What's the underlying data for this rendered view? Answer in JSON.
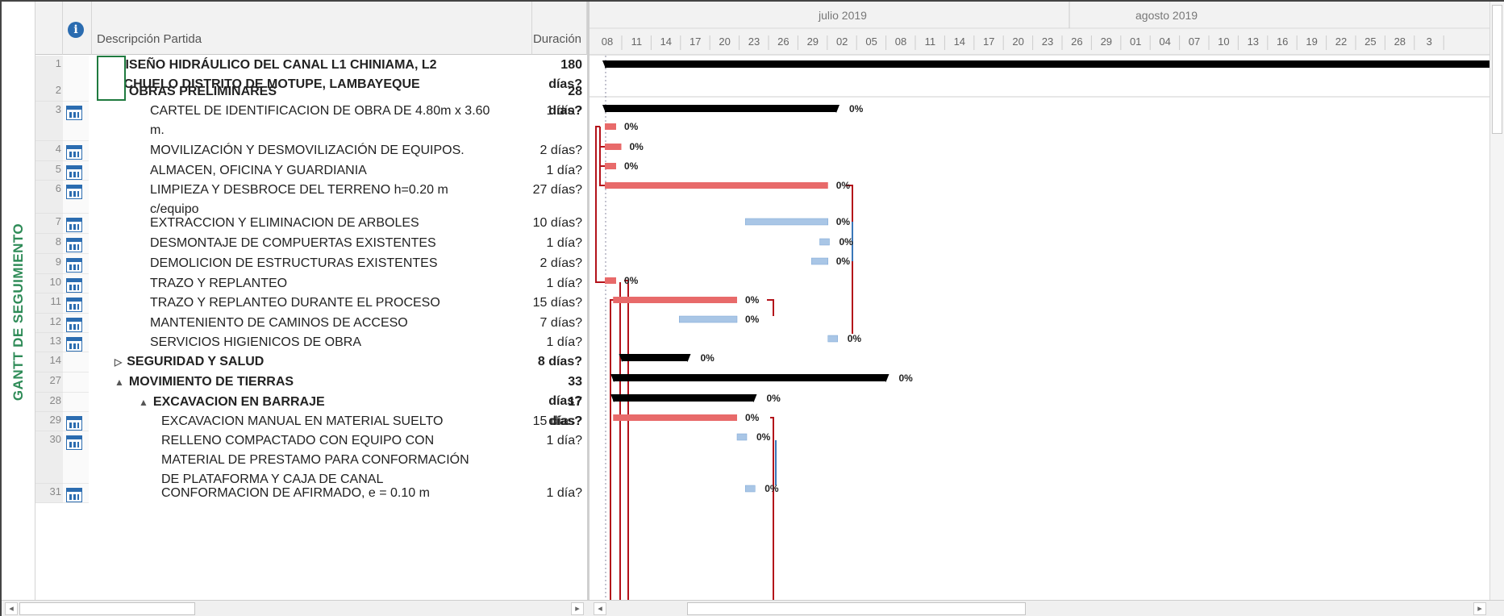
{
  "side_label": "GANTT DE SEGUIMIENTO",
  "columns": {
    "info_icon": "info-icon",
    "name": "Descripción Partida",
    "duration": "Duración"
  },
  "timeline": {
    "months": [
      {
        "label": "julio 2019"
      },
      {
        "label": "agosto 2019"
      }
    ],
    "days": [
      "08",
      "11",
      "14",
      "17",
      "20",
      "23",
      "26",
      "29",
      "02",
      "05",
      "08",
      "11",
      "14",
      "17",
      "20",
      "23",
      "26",
      "29",
      "01",
      "04",
      "07",
      "10",
      "13",
      "16",
      "19",
      "22",
      "25",
      "28",
      "3"
    ]
  },
  "rows": [
    {
      "id": "1",
      "name": "DISEÑO HIDRÁULICO DEL CANAL L1 CHINIAMA, L2",
      "name2": "RIACHUELO DISTRITO DE MOTUPE, LAMBAYEQUE",
      "duration": "180 días?",
      "bold": true,
      "level": 0,
      "expand": "▲",
      "icon": false
    },
    {
      "id": "2",
      "name": "OBRAS PRELIMINARES",
      "duration": "28 días?",
      "bold": true,
      "level": 1,
      "expand": "▲",
      "icon": false
    },
    {
      "id": "3",
      "name": "CARTEL DE IDENTIFICACION DE OBRA DE 4.80m x 3.60",
      "name2": "m.",
      "duration": "1 día?",
      "bold": false,
      "level": 2,
      "icon": true
    },
    {
      "id": "4",
      "name": "MOVILIZACIÓN Y DESMOVILIZACIÓN DE EQUIPOS.",
      "duration": "2 días?",
      "bold": false,
      "level": 2,
      "icon": true
    },
    {
      "id": "5",
      "name": "ALMACEN, OFICINA Y GUARDIANIA",
      "duration": "1 día?",
      "bold": false,
      "level": 2,
      "icon": true
    },
    {
      "id": "6",
      "name": "LIMPIEZA Y DESBROCE DEL TERRENO h=0.20 m",
      "name2": "c/equipo",
      "duration": "27 días?",
      "bold": false,
      "level": 2,
      "icon": true
    },
    {
      "id": "7",
      "name": "EXTRACCION Y ELIMINACION DE ARBOLES",
      "duration": "10 días?",
      "bold": false,
      "level": 2,
      "icon": true
    },
    {
      "id": "8",
      "name": "DESMONTAJE DE COMPUERTAS EXISTENTES",
      "duration": "1 día?",
      "bold": false,
      "level": 2,
      "icon": true
    },
    {
      "id": "9",
      "name": "DEMOLICION DE ESTRUCTURAS EXISTENTES",
      "duration": "2 días?",
      "bold": false,
      "level": 2,
      "icon": true
    },
    {
      "id": "10",
      "name": "TRAZO Y REPLANTEO",
      "duration": "1 día?",
      "bold": false,
      "level": 2,
      "icon": true
    },
    {
      "id": "11",
      "name": "TRAZO Y REPLANTEO DURANTE EL PROCESO",
      "duration": "15 días?",
      "bold": false,
      "level": 2,
      "icon": true
    },
    {
      "id": "12",
      "name": "MANTENIENTO DE CAMINOS DE ACCESO",
      "duration": "7 días?",
      "bold": false,
      "level": 2,
      "icon": true
    },
    {
      "id": "13",
      "name": "SERVICIOS HIGIENICOS DE OBRA",
      "duration": "1 día?",
      "bold": false,
      "level": 2,
      "icon": true
    },
    {
      "id": "14",
      "name": "SEGURIDAD Y SALUD",
      "duration": "8 días?",
      "bold": true,
      "level": 1,
      "expand": "▷",
      "icon": false
    },
    {
      "id": "27",
      "name": "MOVIMIENTO DE TIERRAS",
      "duration": "33 días?",
      "bold": true,
      "level": 1,
      "expand": "▲",
      "icon": false
    },
    {
      "id": "28",
      "name": "EXCAVACION EN BARRAJE",
      "duration": "17 días?",
      "bold": true,
      "level": 2,
      "expand": "▲",
      "icon": false
    },
    {
      "id": "29",
      "name": "EXCAVACION MANUAL EN MATERIAL SUELTO",
      "duration": "15 días?",
      "bold": false,
      "level": 3,
      "icon": true
    },
    {
      "id": "30",
      "name": "RELLENO COMPACTADO CON EQUIPO CON",
      "name2": "MATERIAL DE PRESTAMO PARA CONFORMACIÓN",
      "name3": "DE PLATAFORMA Y CAJA DE CANAL",
      "duration": "1 día?",
      "bold": false,
      "level": 3,
      "icon": true
    },
    {
      "id": "31",
      "name": "CONFORMACION DE AFIRMADO, e = 0.10 m",
      "duration": "1 día?",
      "bold": false,
      "level": 3,
      "icon": true
    }
  ],
  "bars": [
    {
      "row": 0,
      "kind": "summary",
      "start": 0,
      "end": 180,
      "label": ""
    },
    {
      "row": 1,
      "kind": "summary",
      "start": 0,
      "end": 28,
      "label": "0%"
    },
    {
      "row": 2,
      "kind": "critical",
      "start": 0,
      "end": 1,
      "label": "0%"
    },
    {
      "row": 3,
      "kind": "critical",
      "start": 0,
      "end": 2,
      "label": "0%"
    },
    {
      "row": 4,
      "kind": "critical",
      "start": 0,
      "end": 1,
      "label": "0%"
    },
    {
      "row": 5,
      "kind": "critical",
      "start": 0,
      "end": 27,
      "label": "0%"
    },
    {
      "row": 6,
      "kind": "normal",
      "start": 17,
      "end": 27,
      "label": "0%"
    },
    {
      "row": 7,
      "kind": "normal",
      "start": 26,
      "end": 27,
      "label": "0%"
    },
    {
      "row": 8,
      "kind": "normal",
      "start": 25,
      "end": 27,
      "label": "0%"
    },
    {
      "row": 9,
      "kind": "critical",
      "start": 0,
      "end": 1,
      "label": "0%"
    },
    {
      "row": 10,
      "kind": "critical",
      "start": 1,
      "end": 16,
      "label": "0%"
    },
    {
      "row": 11,
      "kind": "normal",
      "start": 9,
      "end": 16,
      "label": "0%"
    },
    {
      "row": 12,
      "kind": "normal",
      "start": 27,
      "end": 28,
      "label": "0%"
    },
    {
      "row": 13,
      "kind": "summary",
      "start": 2,
      "end": 10,
      "label": "0%"
    },
    {
      "row": 14,
      "kind": "summary",
      "start": 1,
      "end": 34,
      "label": "0%"
    },
    {
      "row": 15,
      "kind": "summary",
      "start": 1,
      "end": 18,
      "label": "0%"
    },
    {
      "row": 16,
      "kind": "critical",
      "start": 1,
      "end": 16,
      "label": "0%"
    },
    {
      "row": 17,
      "kind": "normal",
      "start": 16,
      "end": 17,
      "label": "0%"
    },
    {
      "row": 18,
      "kind": "normal",
      "start": 17,
      "end": 18,
      "label": "0%"
    }
  ],
  "colors": {
    "critical": "#e86a6a",
    "normal": "#a9c6e6",
    "summary": "#000000",
    "link_red": "#b3121a",
    "link_blue": "#3a77b8",
    "side_label": "#2e8b57"
  }
}
